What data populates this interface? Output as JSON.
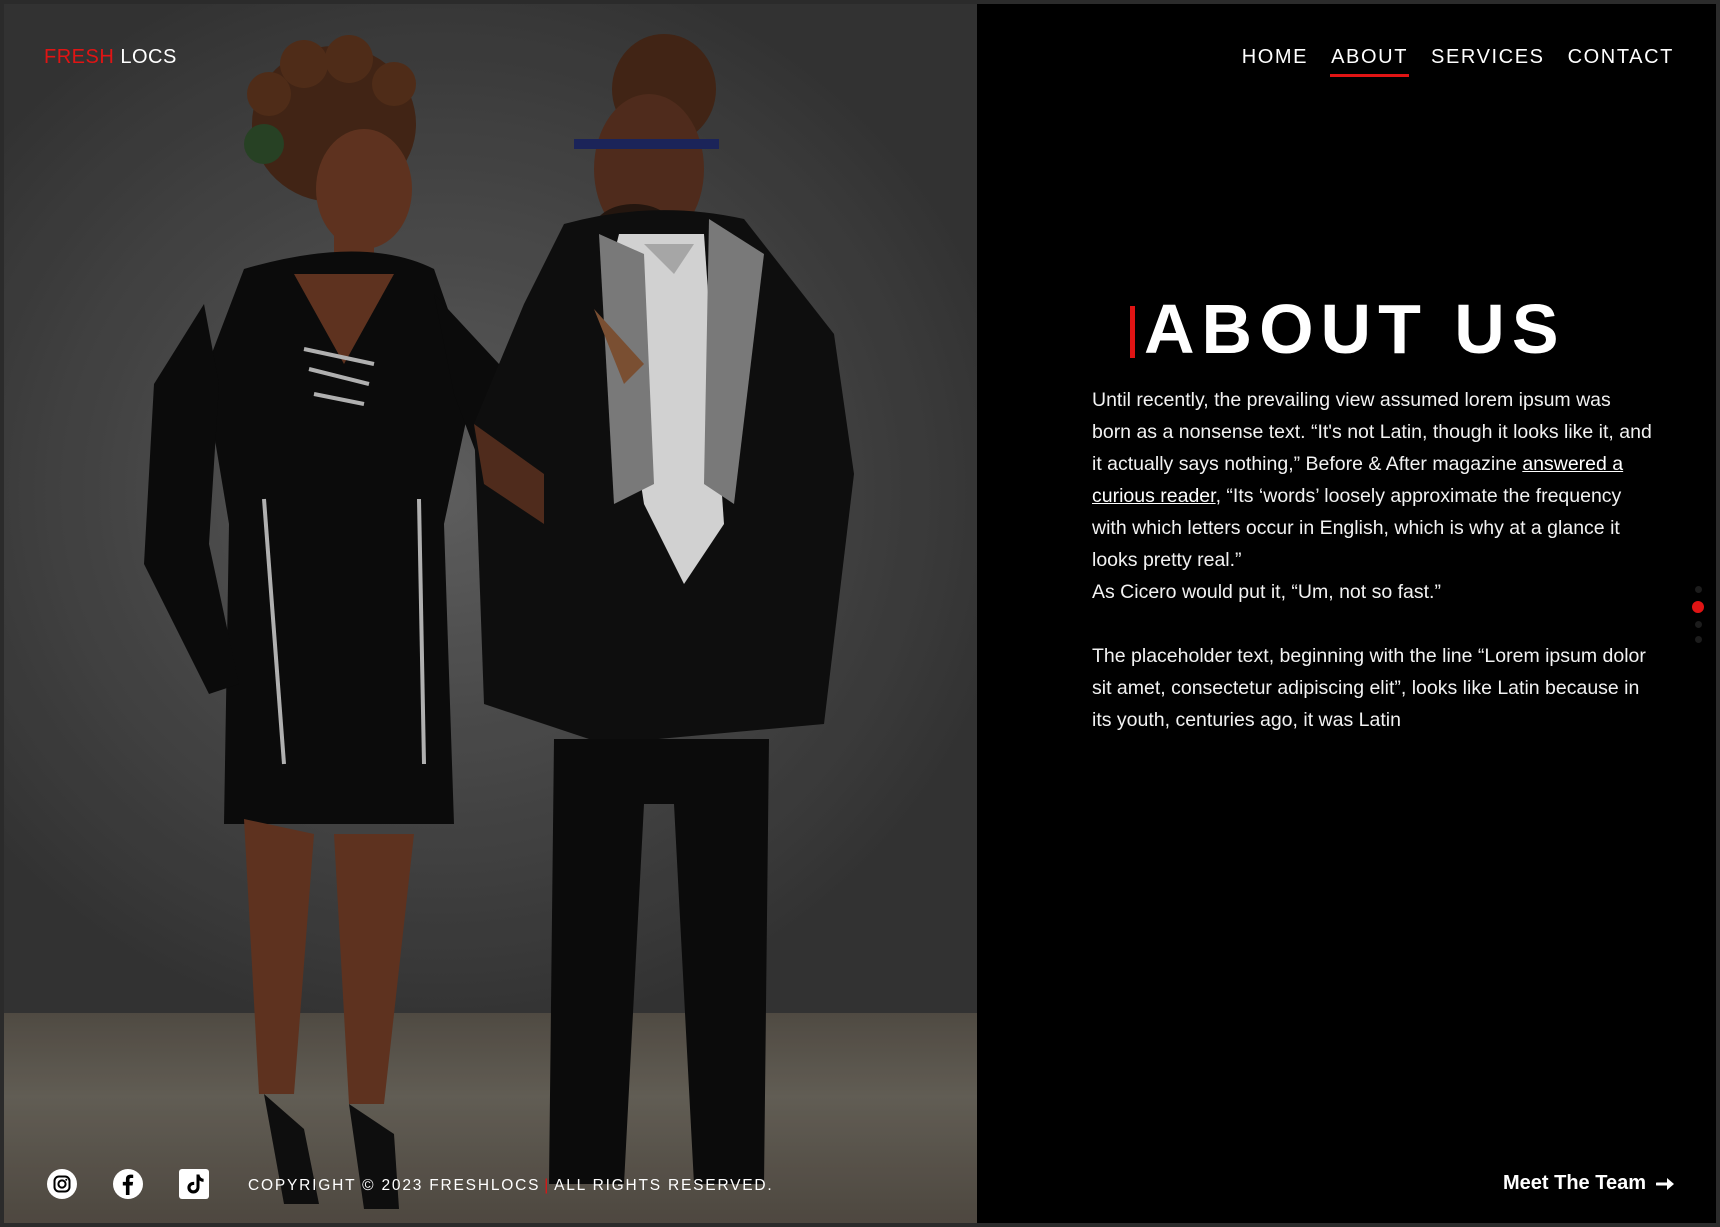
{
  "brand": {
    "logo_part1": "FRESH",
    "logo_part2": "LOCS",
    "accent_color": "#e01414"
  },
  "nav": {
    "items": [
      {
        "label": "HOME"
      },
      {
        "label": "ABOUT"
      },
      {
        "label": "SERVICES"
      },
      {
        "label": "CONTACT"
      }
    ],
    "active": "ABOUT"
  },
  "about": {
    "title": "ABOUT US",
    "p1_a": "Until recently, the prevailing view assumed lorem ipsum was born as a nonsense text. “It's not Latin, though it looks like it, and it actually says nothing,” Before & After magazine ",
    "p1_link": "answered a curious reader",
    "p1_b": ", “Its ‘words’ loosely approximate the frequency with which letters occur in English, which is why at a glance it looks pretty real.”",
    "p2": "As Cicero would put it, “Um, not so fast.”",
    "p3": "The placeholder text, beginning with the line “Lorem ipsum dolor sit amet, consectetur adipiscing elit”, looks like Latin because in its youth, centuries ago, it was Latin"
  },
  "pagination": {
    "active_index": 2,
    "count": 4
  },
  "footer": {
    "socials": [
      "instagram-icon",
      "facebook-icon",
      "tiktok-icon"
    ],
    "copyright_a": "COPYRIGHT © 2023 FRESHLOCS",
    "copyright_sep": "|",
    "copyright_b": "ALL RIGHTS RESERVED.",
    "cta": "Meet The Team"
  }
}
